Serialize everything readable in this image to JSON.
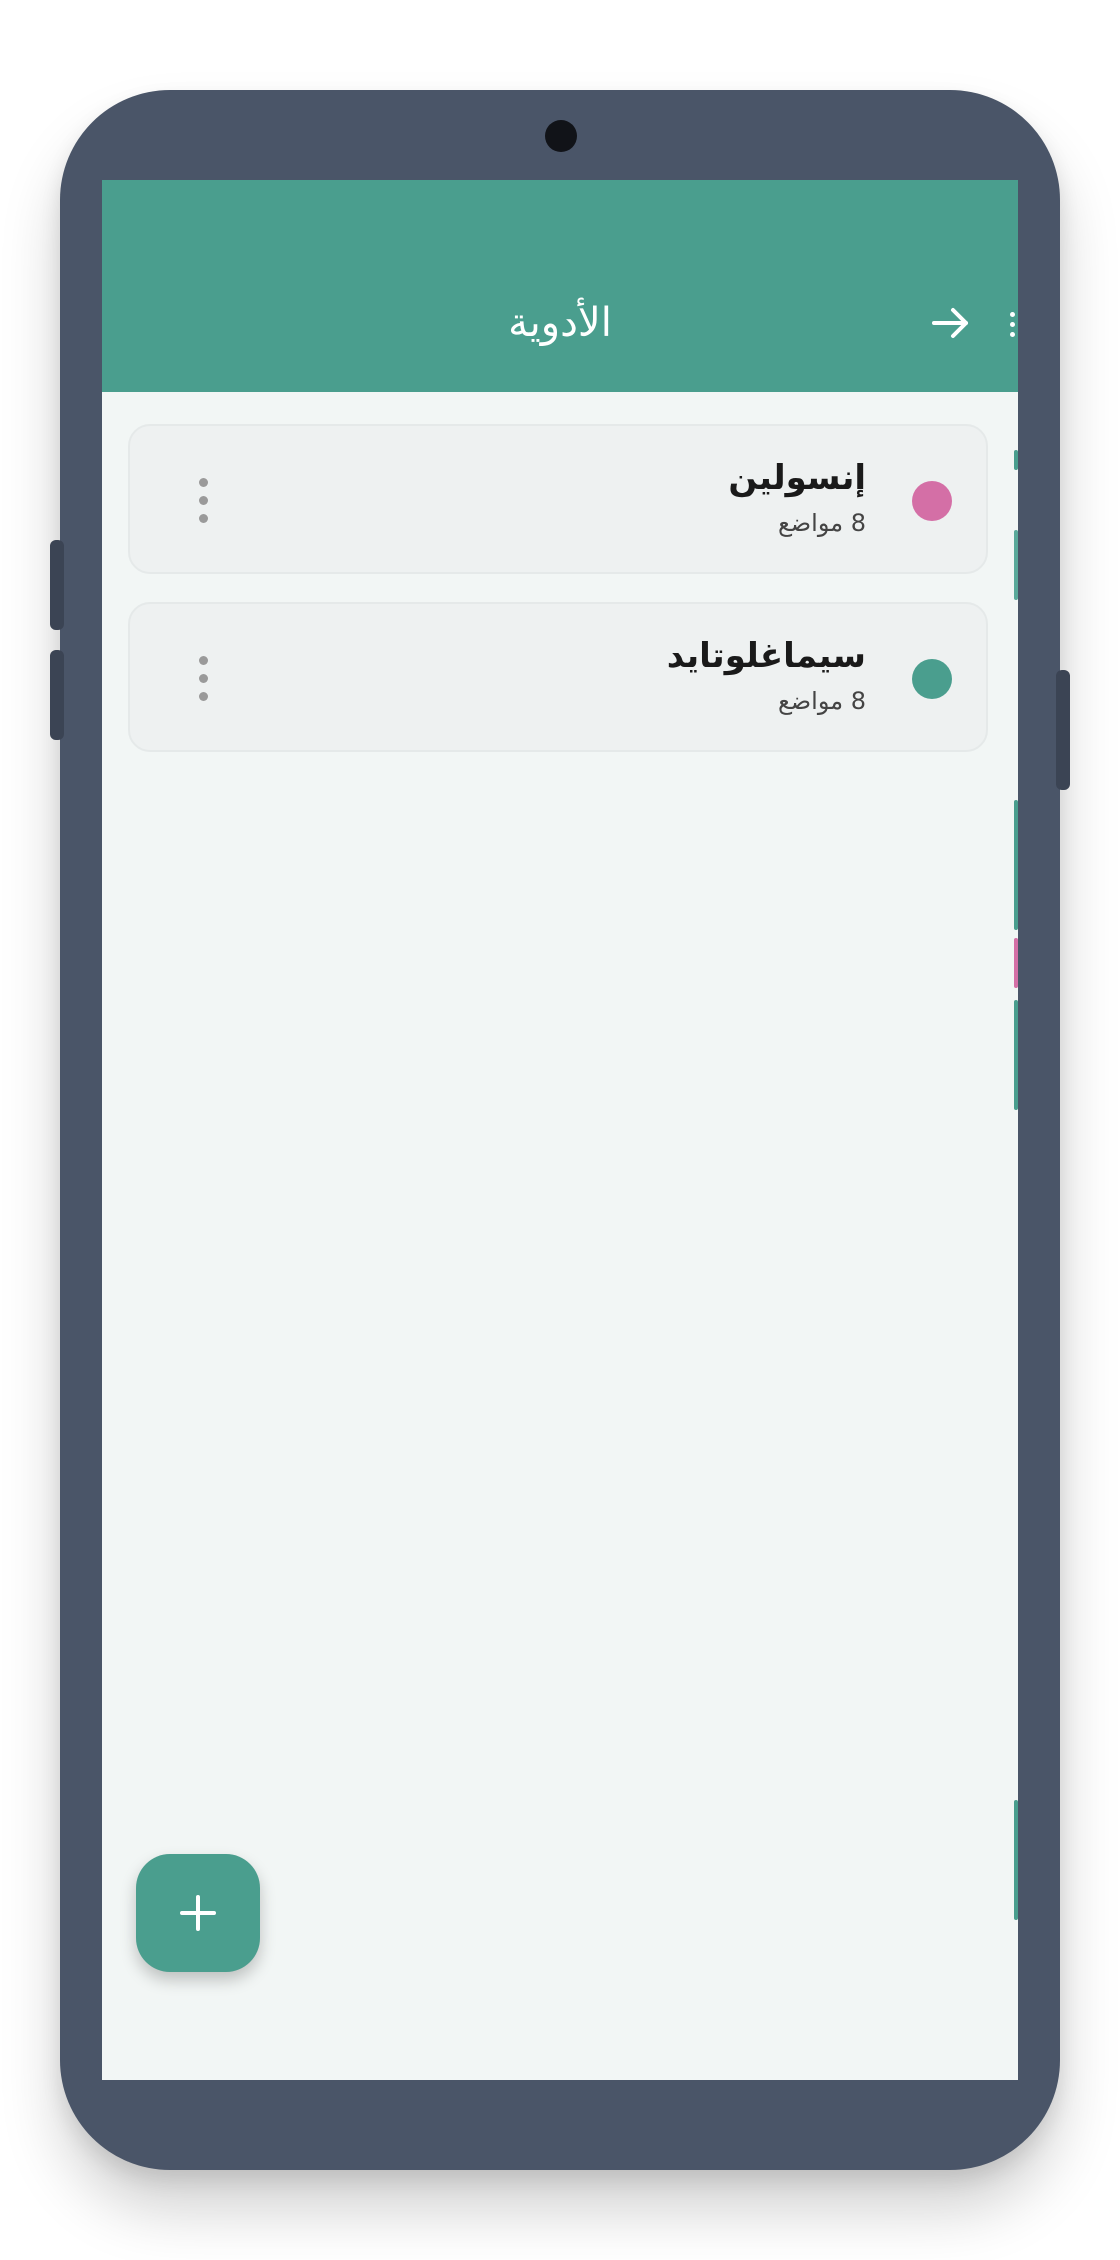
{
  "app_bar": {
    "title": "الأدوية",
    "back_icon": "arrow-right-icon",
    "color": "#4a9e8e"
  },
  "medications": [
    {
      "name": "إنسولين",
      "subtitle": "8 مواضع",
      "color": "#d46fa6"
    },
    {
      "name": "سيماغلوتايد",
      "subtitle": "8 مواضع",
      "color": "#4a9e8e"
    }
  ],
  "fab": {
    "label": "+",
    "icon": "plus-icon"
  },
  "colors": {
    "screen_bg": "#f2f6f5",
    "frame": "#4a5568",
    "accent": "#4a9e8e",
    "pink": "#d46fa6"
  }
}
